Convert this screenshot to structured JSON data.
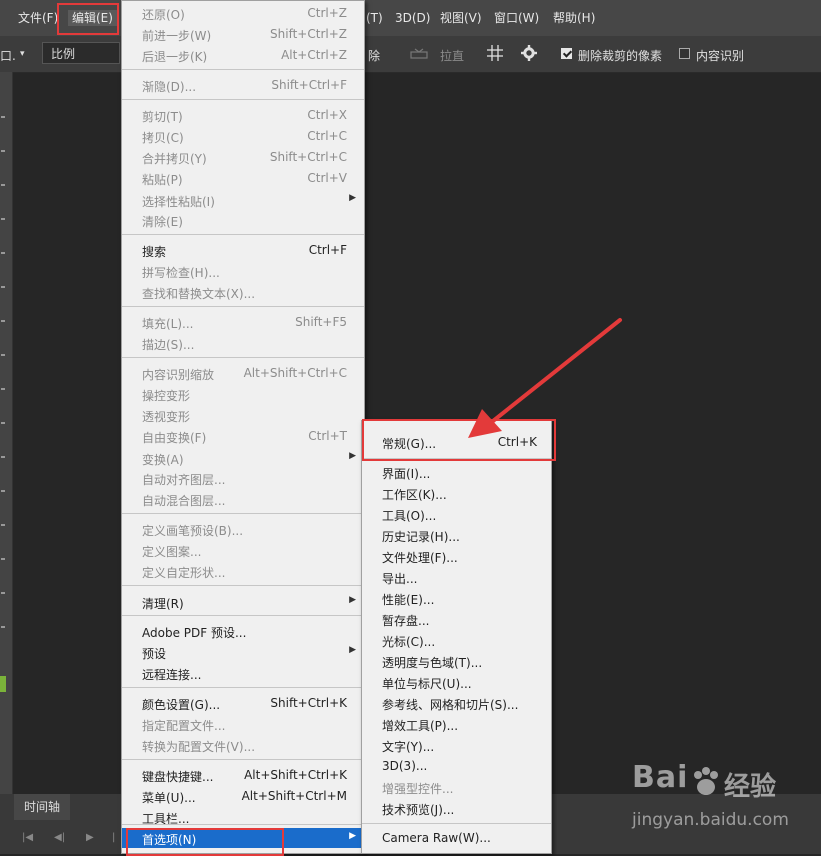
{
  "menubar": {
    "file": "文件(F)",
    "edit": "编辑(E)",
    "type_partial": "(T)",
    "threed": "3D(D)",
    "view": "视图(V)",
    "window": "窗口(W)",
    "help": "帮助(H)"
  },
  "options_bar": {
    "tool_glyph": "口.",
    "ratio_value": "比例",
    "clear_partial": "除",
    "straighten": "拉直",
    "delete_cropped": "删除裁剪的像素",
    "delete_cropped_checked": true,
    "content_aware": "内容识别",
    "content_aware_checked": false
  },
  "timeline": {
    "tab": "时间轴"
  },
  "edit_menu": {
    "items": [
      {
        "label": "还原(O)",
        "shortcut": "Ctrl+Z",
        "disabled": true
      },
      {
        "label": "前进一步(W)",
        "shortcut": "Shift+Ctrl+Z",
        "disabled": true
      },
      {
        "label": "后退一步(K)",
        "shortcut": "Alt+Ctrl+Z",
        "disabled": true
      },
      {
        "label": "渐隐(D)...",
        "shortcut": "Shift+Ctrl+F",
        "disabled": true
      },
      {
        "label": "剪切(T)",
        "shortcut": "Ctrl+X",
        "disabled": true
      },
      {
        "label": "拷贝(C)",
        "shortcut": "Ctrl+C",
        "disabled": true
      },
      {
        "label": "合并拷贝(Y)",
        "shortcut": "Shift+Ctrl+C",
        "disabled": true
      },
      {
        "label": "粘贴(P)",
        "shortcut": "Ctrl+V",
        "disabled": true
      },
      {
        "label": "选择性粘贴(I)",
        "shortcut": "",
        "disabled": true
      },
      {
        "label": "清除(E)",
        "shortcut": "",
        "disabled": true
      },
      {
        "label": "搜索",
        "shortcut": "Ctrl+F",
        "disabled": false
      },
      {
        "label": "拼写检查(H)...",
        "shortcut": "",
        "disabled": true
      },
      {
        "label": "查找和替换文本(X)...",
        "shortcut": "",
        "disabled": true
      },
      {
        "label": "填充(L)...",
        "shortcut": "Shift+F5",
        "disabled": true
      },
      {
        "label": "描边(S)...",
        "shortcut": "",
        "disabled": true
      },
      {
        "label": "内容识别缩放",
        "shortcut": "Alt+Shift+Ctrl+C",
        "disabled": true
      },
      {
        "label": "操控变形",
        "shortcut": "",
        "disabled": true
      },
      {
        "label": "透视变形",
        "shortcut": "",
        "disabled": true
      },
      {
        "label": "自由变换(F)",
        "shortcut": "Ctrl+T",
        "disabled": true
      },
      {
        "label": "变换(A)",
        "shortcut": "",
        "disabled": true
      },
      {
        "label": "自动对齐图层...",
        "shortcut": "",
        "disabled": true
      },
      {
        "label": "自动混合图层...",
        "shortcut": "",
        "disabled": true
      },
      {
        "label": "定义画笔预设(B)...",
        "shortcut": "",
        "disabled": true
      },
      {
        "label": "定义图案...",
        "shortcut": "",
        "disabled": true
      },
      {
        "label": "定义自定形状...",
        "shortcut": "",
        "disabled": true
      },
      {
        "label": "清理(R)",
        "shortcut": "",
        "disabled": false
      },
      {
        "label": "Adobe PDF 预设...",
        "shortcut": "",
        "disabled": false
      },
      {
        "label": "预设",
        "shortcut": "",
        "disabled": false
      },
      {
        "label": "远程连接...",
        "shortcut": "",
        "disabled": false
      },
      {
        "label": "颜色设置(G)...",
        "shortcut": "Shift+Ctrl+K",
        "disabled": false
      },
      {
        "label": "指定配置文件...",
        "shortcut": "",
        "disabled": true
      },
      {
        "label": "转换为配置文件(V)...",
        "shortcut": "",
        "disabled": true
      },
      {
        "label": "键盘快捷键...",
        "shortcut": "Alt+Shift+Ctrl+K",
        "disabled": false
      },
      {
        "label": "菜单(U)...",
        "shortcut": "Alt+Shift+Ctrl+M",
        "disabled": false
      },
      {
        "label": "工具栏...",
        "shortcut": "",
        "disabled": false
      },
      {
        "label": "首选项(N)",
        "shortcut": "",
        "disabled": false
      }
    ]
  },
  "prefs_submenu": {
    "items": [
      {
        "label": "常规(G)...",
        "shortcut": "Ctrl+K",
        "disabled": false
      },
      {
        "label": "界面(I)...",
        "shortcut": "",
        "disabled": false
      },
      {
        "label": "工作区(K)...",
        "shortcut": "",
        "disabled": false
      },
      {
        "label": "工具(O)...",
        "shortcut": "",
        "disabled": false
      },
      {
        "label": "历史记录(H)...",
        "shortcut": "",
        "disabled": false
      },
      {
        "label": "文件处理(F)...",
        "shortcut": "",
        "disabled": false
      },
      {
        "label": "导出...",
        "shortcut": "",
        "disabled": false
      },
      {
        "label": "性能(E)...",
        "shortcut": "",
        "disabled": false
      },
      {
        "label": "暂存盘...",
        "shortcut": "",
        "disabled": false
      },
      {
        "label": "光标(C)...",
        "shortcut": "",
        "disabled": false
      },
      {
        "label": "透明度与色域(T)...",
        "shortcut": "",
        "disabled": false
      },
      {
        "label": "单位与标尺(U)...",
        "shortcut": "",
        "disabled": false
      },
      {
        "label": "参考线、网格和切片(S)...",
        "shortcut": "",
        "disabled": false
      },
      {
        "label": "增效工具(P)...",
        "shortcut": "",
        "disabled": false
      },
      {
        "label": "文字(Y)...",
        "shortcut": "",
        "disabled": false
      },
      {
        "label": "3D(3)...",
        "shortcut": "",
        "disabled": false
      },
      {
        "label": "增强型控件...",
        "shortcut": "",
        "disabled": true
      },
      {
        "label": "技术预览(J)...",
        "shortcut": "",
        "disabled": false
      },
      {
        "label": "Camera Raw(W)...",
        "shortcut": "",
        "disabled": false
      }
    ]
  },
  "watermark": {
    "word": "Bai",
    "cn": "经验",
    "url": "jingyan.baidu.com"
  },
  "colors": {
    "highlight": "#1a6ccb",
    "annotation": "#e33a3a"
  }
}
